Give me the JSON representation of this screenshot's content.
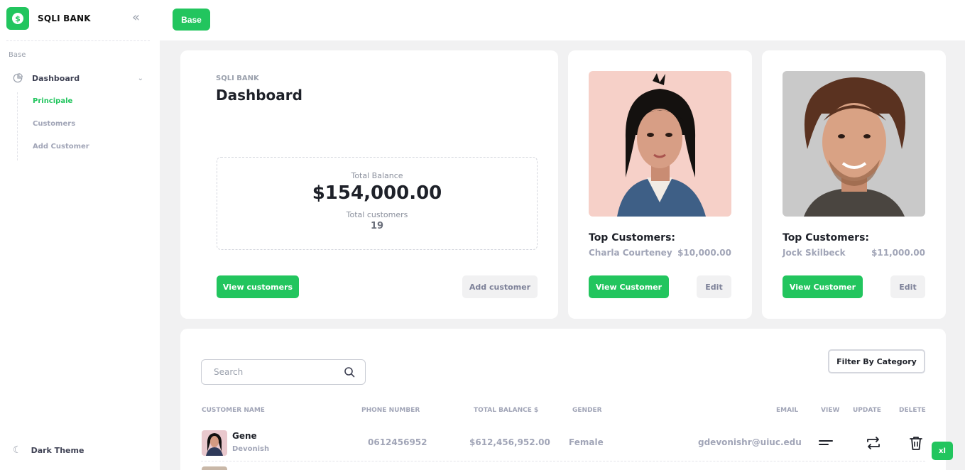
{
  "brand": {
    "name": "SQLI BANK",
    "logo_symbol": "$"
  },
  "sidebar": {
    "section_label": "Base",
    "dashboard_label": "Dashboard",
    "items": [
      {
        "label": "Principale",
        "active": true
      },
      {
        "label": "Customers",
        "active": false
      },
      {
        "label": "Add Customer",
        "active": false
      }
    ],
    "dark_theme_label": "Dark Theme"
  },
  "topbar": {
    "base_button": "Base"
  },
  "dashboard": {
    "small_label": "SQLI BANK",
    "title": "Dashboard",
    "total_balance_label": "Total Balance",
    "total_balance_value": "$154,000.00",
    "total_customers_label": "Total customers",
    "total_customers_value": "19",
    "view_customers_button": "View customers",
    "add_customer_button": "Add customer"
  },
  "top_customers": [
    {
      "title": "Top Customers:",
      "name": "Charla Courteney",
      "amount": "$10,000.00",
      "view_button": "View Customer",
      "edit_button": "Edit"
    },
    {
      "title": "Top Customers:",
      "name": "Jock Skilbeck",
      "amount": "$11,000.00",
      "view_button": "View Customer",
      "edit_button": "Edit"
    }
  ],
  "table": {
    "search_placeholder": "Search",
    "filter_button": "Filter By Category",
    "columns": [
      "CUSTOMER NAME",
      "PHONE NUMBER",
      "TOTAL BALANCE $",
      "GENDER",
      "EMAIL",
      "VIEW",
      "UPDATE",
      "DELETE"
    ],
    "rows": [
      {
        "first_name": "Gene",
        "last_name": "Devonish",
        "phone": "0612456952",
        "balance": "$612,456,952.00",
        "gender": "Female",
        "email": "gdevonishr@uiuc.edu"
      }
    ]
  },
  "badge": "xl",
  "colors": {
    "accent": "#22c55e",
    "muted": "#a1a5b7",
    "text": "#1e2129",
    "background": "#f1f1f2"
  },
  "icons": [
    "dollar-icon",
    "double-chevron-left-icon",
    "pie-chart-icon",
    "chevron-down-icon",
    "moon-icon",
    "search-icon",
    "menu-lines-icon",
    "repeat-icon",
    "trash-icon"
  ]
}
